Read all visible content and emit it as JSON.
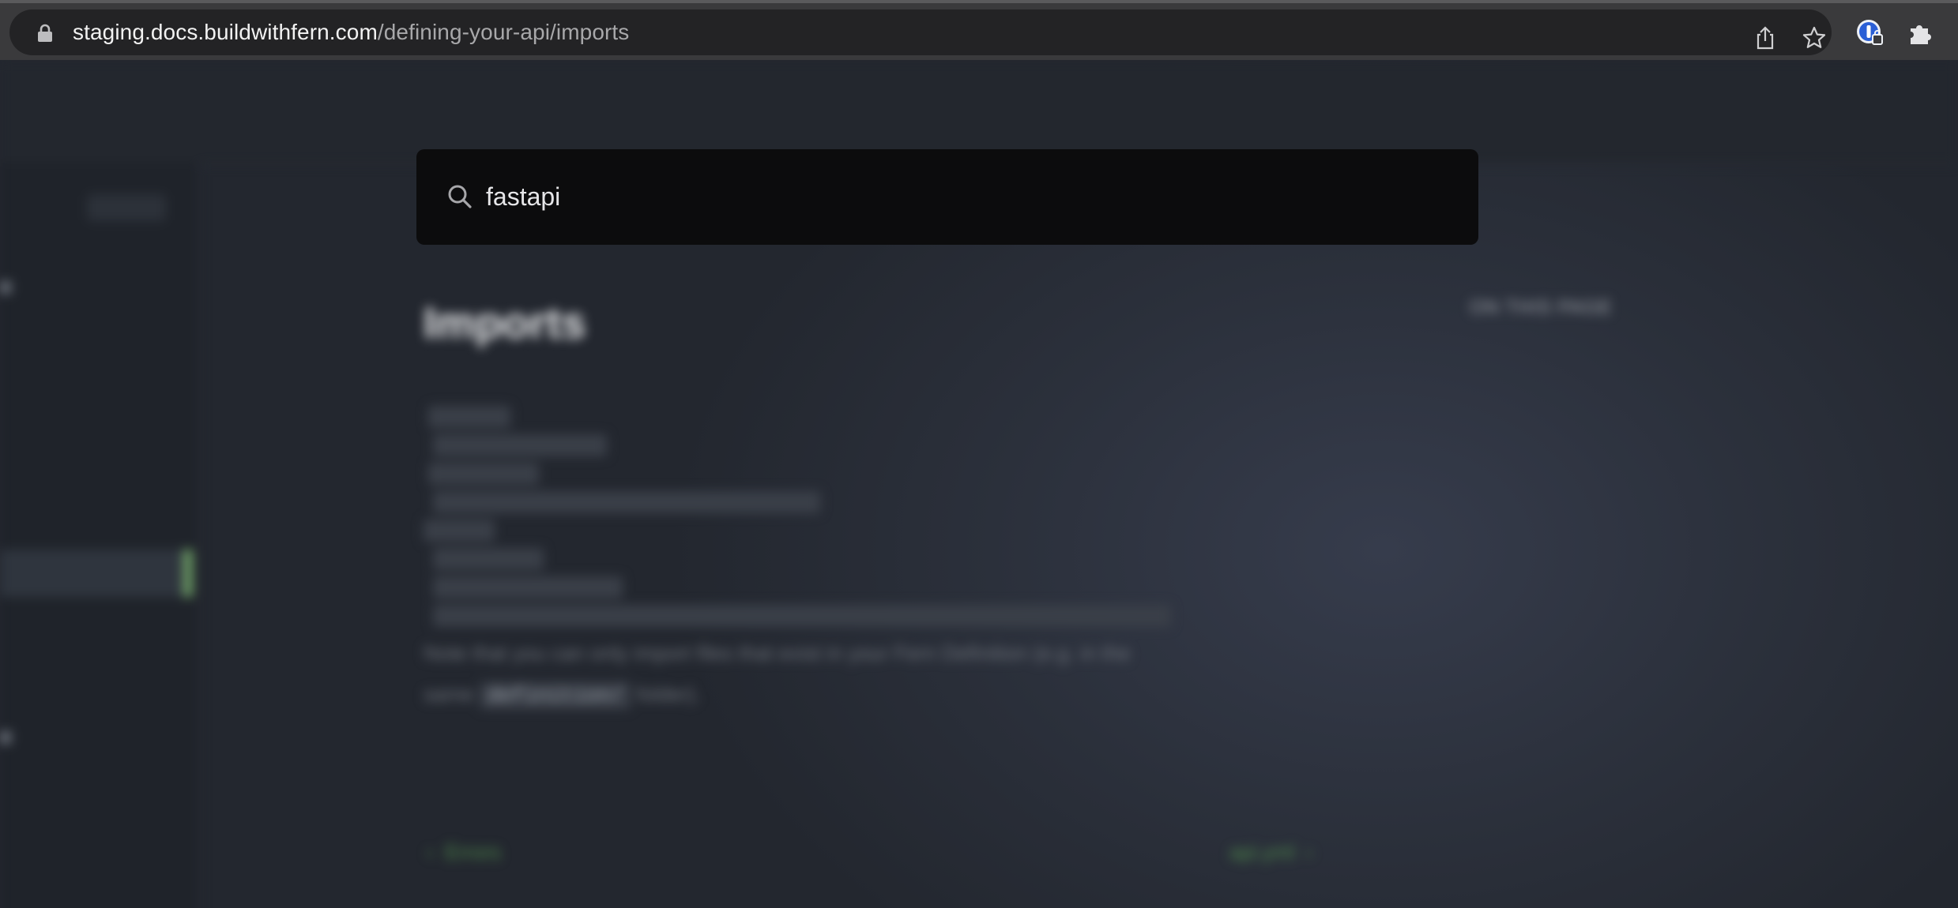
{
  "browser": {
    "url_domain": "staging.docs.buildwithfern.com",
    "url_path": "/defining-your-api/imports",
    "icons": [
      "lock-icon",
      "share-icon",
      "star-icon",
      "1password-extension-icon",
      "puzzle-extensions-icon"
    ]
  },
  "search": {
    "value": "fastapi",
    "icon": "search-icon"
  },
  "page": {
    "title": "Imports",
    "toc_heading": "ON THIS PAGE",
    "prose_prefix": "Note that you can only import files that exist in your Fern Definition (e.g. in the",
    "prose_word": "same",
    "prose_code": "definition/",
    "prose_suffix": "folder).",
    "prev_link": "Errors",
    "next_link": "api.yml"
  },
  "colors": {
    "modal_background": "#0c0c0d",
    "page_background": "#23272f",
    "accent_green": "#8bd17c"
  }
}
